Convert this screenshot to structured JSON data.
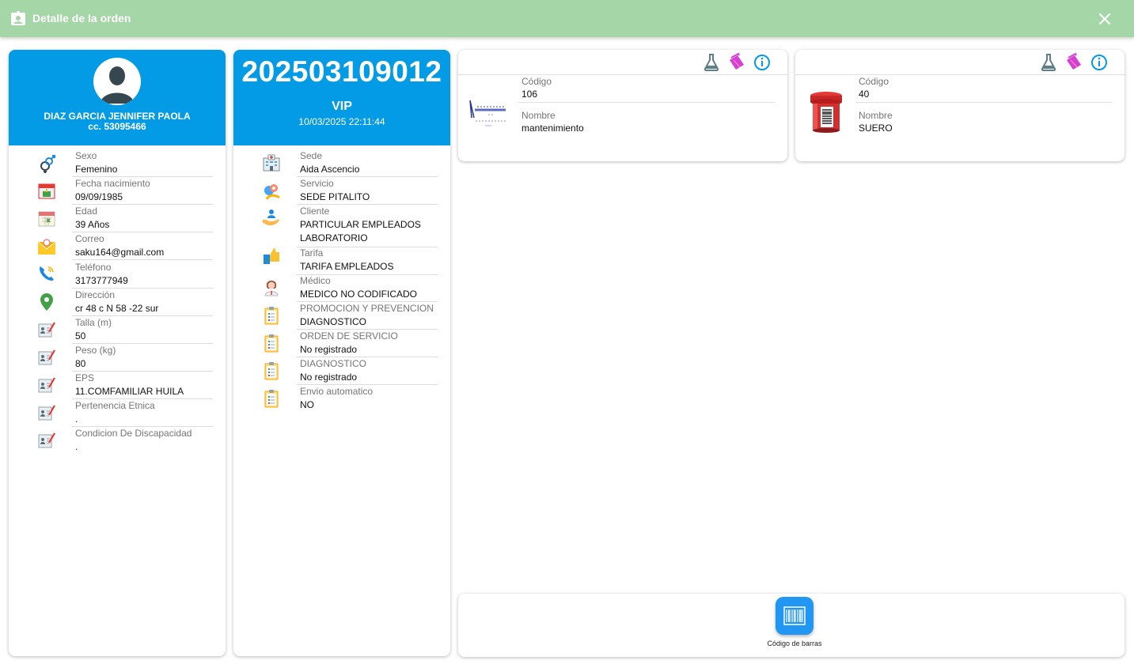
{
  "header": {
    "title": "Detalle de la orden",
    "icon": "contact-badge-icon",
    "close_icon": "close-icon"
  },
  "patient": {
    "name": "DIAZ GARCIA JENNIFER PAOLA",
    "document": "cc. 53095466",
    "fields": [
      {
        "label": "Sexo",
        "value": "Femenino",
        "icon": "gender-icon"
      },
      {
        "label": "Fecha nacimiento",
        "value": "09/09/1985",
        "icon": "calendar-birthday-icon"
      },
      {
        "label": "Edad",
        "value": "39 Años",
        "icon": "calendar-icon"
      },
      {
        "label": "Correo",
        "value": "saku164@gmail.com",
        "icon": "email-icon"
      },
      {
        "label": "Teléfono",
        "value": "3173777949",
        "icon": "phone-icon"
      },
      {
        "label": "Dirección",
        "value": "cr 48 c N 58 -22 sur",
        "icon": "location-icon"
      },
      {
        "label": "Talla (m)",
        "value": "50",
        "icon": "record-card-icon"
      },
      {
        "label": "Peso (kg)",
        "value": "80",
        "icon": "record-card-icon"
      },
      {
        "label": "EPS",
        "value": "11.COMFAMILIAR HUILA",
        "icon": "record-card-icon"
      },
      {
        "label": "Pertenencia Etnica",
        "value": ".",
        "icon": "record-card-icon"
      },
      {
        "label": "Condicion De Discapacidad",
        "value": ".",
        "icon": "record-card-icon"
      }
    ]
  },
  "order": {
    "number": "202503109012",
    "priority": "VIP",
    "datetime": "10/03/2025 22:11:44",
    "fields": [
      {
        "label": "Sede",
        "value": "Aida Ascencio",
        "icon": "hospital-icon"
      },
      {
        "label": "Servicio",
        "value": "SEDE PITALITO",
        "icon": "service-icon"
      },
      {
        "label": "Cliente",
        "value": "PARTICULAR EMPLEADOS LABORATORIO",
        "icon": "client-icon"
      },
      {
        "label": "Tarifa",
        "value": "TARIFA EMPLEADOS",
        "icon": "tariff-icon"
      },
      {
        "label": "Médico",
        "value": "MEDICO NO CODIFICADO",
        "icon": "doctor-icon"
      },
      {
        "label": "PROMOCION Y PREVENCION",
        "value": "DIAGNOSTICO",
        "icon": "clipboard-icon"
      },
      {
        "label": "ORDEN DE SERVICIO",
        "value": "No registrado",
        "icon": "clipboard-icon"
      },
      {
        "label": "DIAGNOSTICO",
        "value": "No registrado",
        "icon": "clipboard-icon"
      },
      {
        "label": "Envio automatico",
        "value": "NO",
        "icon": "clipboard-icon"
      }
    ]
  },
  "tests": [
    {
      "code_label": "Código",
      "code": "106",
      "name_label": "Nombre",
      "name": "mantenimiento",
      "image": "maintenance-logo-icon"
    },
    {
      "code_label": "Código",
      "code": "40",
      "name_label": "Nombre",
      "name": "SUERO",
      "image": "serum-tube-icon"
    }
  ],
  "test_actions": [
    "flask-icon",
    "tag-icon",
    "info-icon"
  ],
  "colors": {
    "header_green": "#a5d6a7",
    "card_blue": "#039be5",
    "button_blue": "#2196f3",
    "accent_magenta": "#d63ed6"
  },
  "footer": {
    "barcode_label": "Código de barras",
    "barcode_icon": "barcode-icon"
  }
}
